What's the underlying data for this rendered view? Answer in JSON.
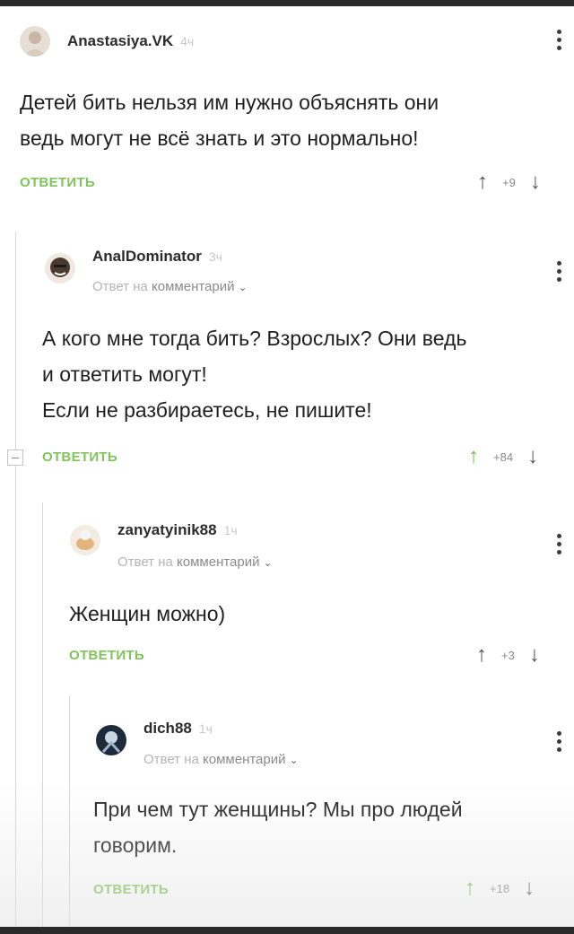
{
  "reply_link_prefix": "Ответ на",
  "reply_link_text": "комментарий",
  "comments": [
    {
      "username": "Anastasiya.VK",
      "time": "4ч",
      "text_lines": [
        "Детей бить нельзя им нужно объяснять они",
        "ведь могут не всё знать и это нормально!"
      ],
      "reply_label": "ОТВЕТИТЬ",
      "score": "+9",
      "upvoted": false
    },
    {
      "username": "AnalDominator",
      "time": "3ч",
      "text_lines": [
        "А кого мне тогда бить? Взрослых? Они ведь",
        "и ответить могут!",
        "Если не разбираетесь, не пишите!"
      ],
      "reply_label": "ОТВЕТИТЬ",
      "score": "+84",
      "upvoted": true
    },
    {
      "username": "zanyatyinik88",
      "time": "1ч",
      "text_lines": [
        "Женщин можно)"
      ],
      "reply_label": "ОТВЕТИТЬ",
      "score": "+3",
      "upvoted": false
    },
    {
      "username": "dich88",
      "time": "1ч",
      "text_lines": [
        "При чем тут женщины? Мы про людей",
        "говорим."
      ],
      "reply_label": "ОТВЕТИТЬ",
      "score": "+18",
      "upvoted": true
    }
  ],
  "colors": {
    "accent_green": "#7fc45a",
    "upvote_active": "#6dbd4a",
    "muted_text": "#b5b5b5"
  },
  "icons": [
    "kebab-menu-icon",
    "upvote-arrow-icon",
    "downvote-arrow-icon",
    "chevron-down-icon",
    "collapse-thread-icon"
  ]
}
